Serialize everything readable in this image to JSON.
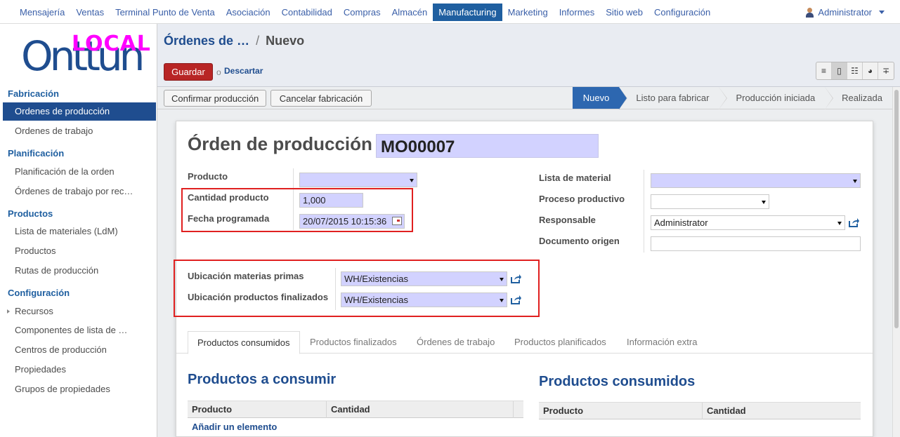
{
  "topmenu": {
    "items": [
      "Mensajería",
      "Ventas",
      "Terminal Punto de Venta",
      "Asociación",
      "Contabilidad",
      "Compras",
      "Almacén",
      "Manufacturing",
      "Marketing",
      "Informes",
      "Sitio web",
      "Configuración"
    ],
    "active": "Manufacturing",
    "user": "Administrator"
  },
  "logo": {
    "main": "Onttun",
    "badge": "LOCAL",
    "badge_color": "#ff00ff",
    "main_color": "#1f4d8f"
  },
  "sidebar": {
    "sections": [
      {
        "title": "Fabricación",
        "items": [
          "Ordenes de producción",
          "Ordenes de trabajo"
        ]
      },
      {
        "title": "Planificación",
        "items": [
          "Planificación de la orden",
          "Órdenes de trabajo por rec…"
        ]
      },
      {
        "title": "Productos",
        "items": [
          "Lista de materiales (LdM)",
          "Productos",
          "Rutas de producción"
        ]
      },
      {
        "title": "Configuración",
        "items": [
          "Recursos",
          "Componentes de lista de …",
          "Centros de producción",
          "Propiedades",
          "Grupos de propiedades"
        ]
      }
    ],
    "active_item": "Ordenes de producción"
  },
  "breadcrumb": {
    "parent": "Órdenes de …",
    "separator": "/",
    "current": "Nuevo"
  },
  "actions": {
    "save": "Guardar",
    "or": "o",
    "discard": "Descartar"
  },
  "view_switcher": [
    "list-view-icon",
    "form-view-icon",
    "calendar-view-icon",
    "graph-view-icon",
    "gantt-view-icon"
  ],
  "header_buttons": {
    "confirm": "Confirmar producción",
    "cancel": "Cancelar fabricación"
  },
  "stages": [
    "Nuevo",
    "Listo para fabricar",
    "Producción iniciada",
    "Realizada"
  ],
  "active_stage": "Nuevo",
  "form": {
    "title_label": "Órden de producción",
    "reference": "MO00007",
    "product_label": "Producto",
    "product_value": "",
    "qty_label": "Cantidad producto",
    "qty_value": "1,000",
    "date_label": "Fecha programada",
    "date_value": "20/07/2015 10:15:36",
    "bom_label": "Lista de material",
    "bom_value": "",
    "routing_label": "Proceso productivo",
    "routing_value": "",
    "responsible_label": "Responsable",
    "responsible_value": "Administrator",
    "origin_label": "Documento origen",
    "origin_value": "",
    "src_loc_label": "Ubicación materias primas",
    "src_loc_value": "WH/Existencias",
    "dest_loc_label": "Ubicación productos finalizados",
    "dest_loc_value": "WH/Existencias"
  },
  "tabs": [
    "Productos consumidos",
    "Productos finalizados",
    "Órdenes de trabajo",
    "Productos planificados",
    "Información extra"
  ],
  "active_tab": "Productos consumidos",
  "to_consume": {
    "title": "Productos a consumir",
    "columns": [
      "Producto",
      "Cantidad"
    ],
    "add_line": "Añadir un elemento"
  },
  "consumed": {
    "title": "Productos consumidos",
    "columns": [
      "Producto",
      "Cantidad"
    ]
  },
  "colors": {
    "highlight_box": "#e02020",
    "required_field": "#d2d2ff",
    "primary": "#1f4d8f",
    "save_button": "#b82525"
  }
}
